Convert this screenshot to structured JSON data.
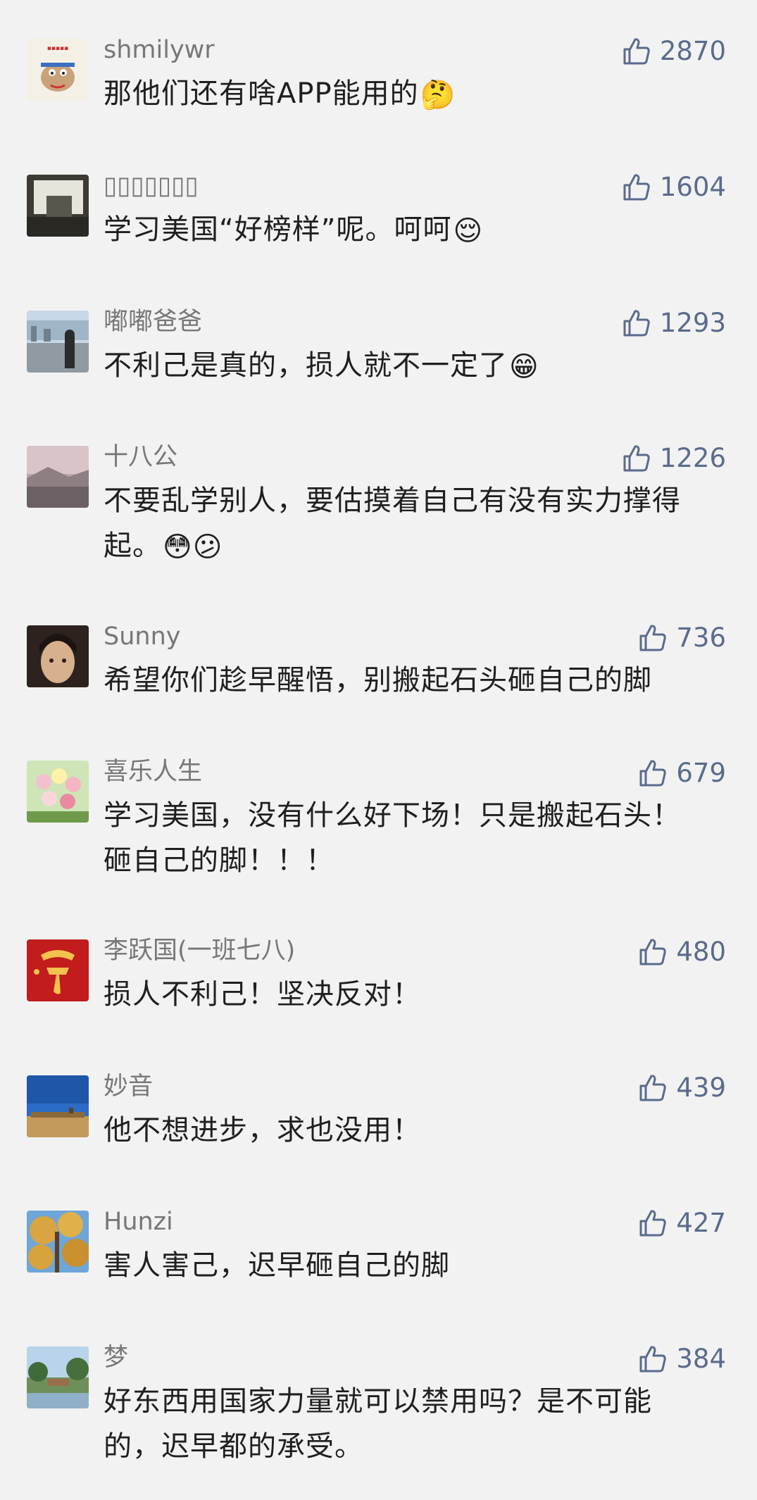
{
  "comments": [
    {
      "username": "shmilywr",
      "likes": "2870",
      "text": "那他们还有啥APP能用的",
      "emoji": "🤔",
      "avatar": "cartoon-avatar"
    },
    {
      "username": "▯▯▯▯▯▯▯",
      "likes": "1604",
      "text": "学习美国“好榜样”呢。呵呵",
      "emoji": "😌",
      "avatar": "photo-avatar"
    },
    {
      "username": "嘟嘟爸爸",
      "likes": "1293",
      "text": "不利己是真的，损人就不一定了",
      "emoji": "😁",
      "avatar": "photo-avatar"
    },
    {
      "username": "十八公",
      "likes": "1226",
      "text": "不要乱学别人，要估摸着自己有没有实力撑得起。",
      "emoji": "😳😕",
      "avatar": "landscape-avatar"
    },
    {
      "username": "Sunny",
      "likes": "736",
      "text": "希望你们趁早醒悟，别搬起石头砸自己的脚",
      "emoji": "",
      "avatar": "portrait-avatar"
    },
    {
      "username": "喜乐人生",
      "likes": "679",
      "text": "学习美国，没有什么好下场！只是搬起石头！砸自己的脚！！！",
      "emoji": "",
      "avatar": "flowers-avatar"
    },
    {
      "username": "李跃国(一班七八)",
      "likes": "480",
      "text": "损人不利己！坚决反对！",
      "emoji": "",
      "avatar": "red-calligraphy-avatar"
    },
    {
      "username": "妙音",
      "likes": "439",
      "text": "他不想进步，求也没用！",
      "emoji": "",
      "avatar": "sky-avatar"
    },
    {
      "username": "Hunzi",
      "likes": "427",
      "text": "害人害己，迟早砸自己的脚",
      "emoji": "",
      "avatar": "tree-avatar"
    },
    {
      "username": "梦",
      "likes": "384",
      "text": "好东西用国家力量就可以禁用吗？是不可能的，迟早都的承受。",
      "emoji": "",
      "avatar": "park-avatar"
    }
  ]
}
